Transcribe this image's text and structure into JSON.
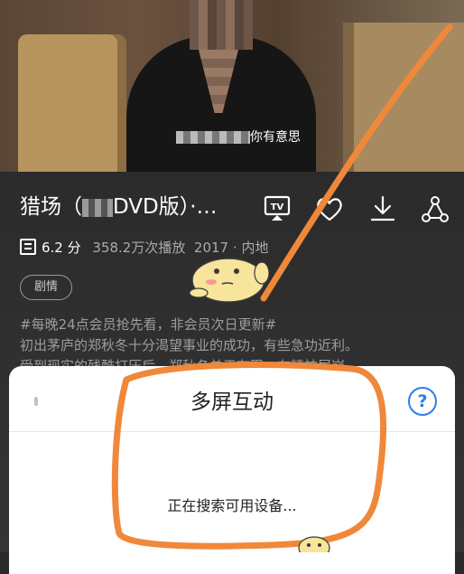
{
  "video": {
    "subtitle_prefix": "",
    "subtitle_suffix": "你有意思"
  },
  "show": {
    "title_prefix": "猎场（",
    "title_suffix": "DVD版）·…",
    "rating": "6.2 分",
    "plays": "358.2万次播放",
    "year": "2017",
    "separator": "·",
    "region": "内地",
    "tag": "剧情",
    "description": [
      "#每晚24点会员抢先看，非会员次日更新#",
      "初出茅庐的郑秋冬十分渴望事业的成功，有些急功近利。",
      "受到现实的残酷打压后，郑秋冬单于有限，在精神层崩"
    ]
  },
  "icons": {
    "tv": "tv-cast-icon",
    "favorite": "heart-icon",
    "download": "download-icon",
    "share": "share-icon",
    "rating": "douban-icon",
    "help": "question-icon"
  },
  "sheet": {
    "title": "多屏互动",
    "help_label": "?",
    "status": "正在搜索可用设备..."
  },
  "colors": {
    "accent": "#2a7ee8",
    "annotation": "#f0883a"
  }
}
